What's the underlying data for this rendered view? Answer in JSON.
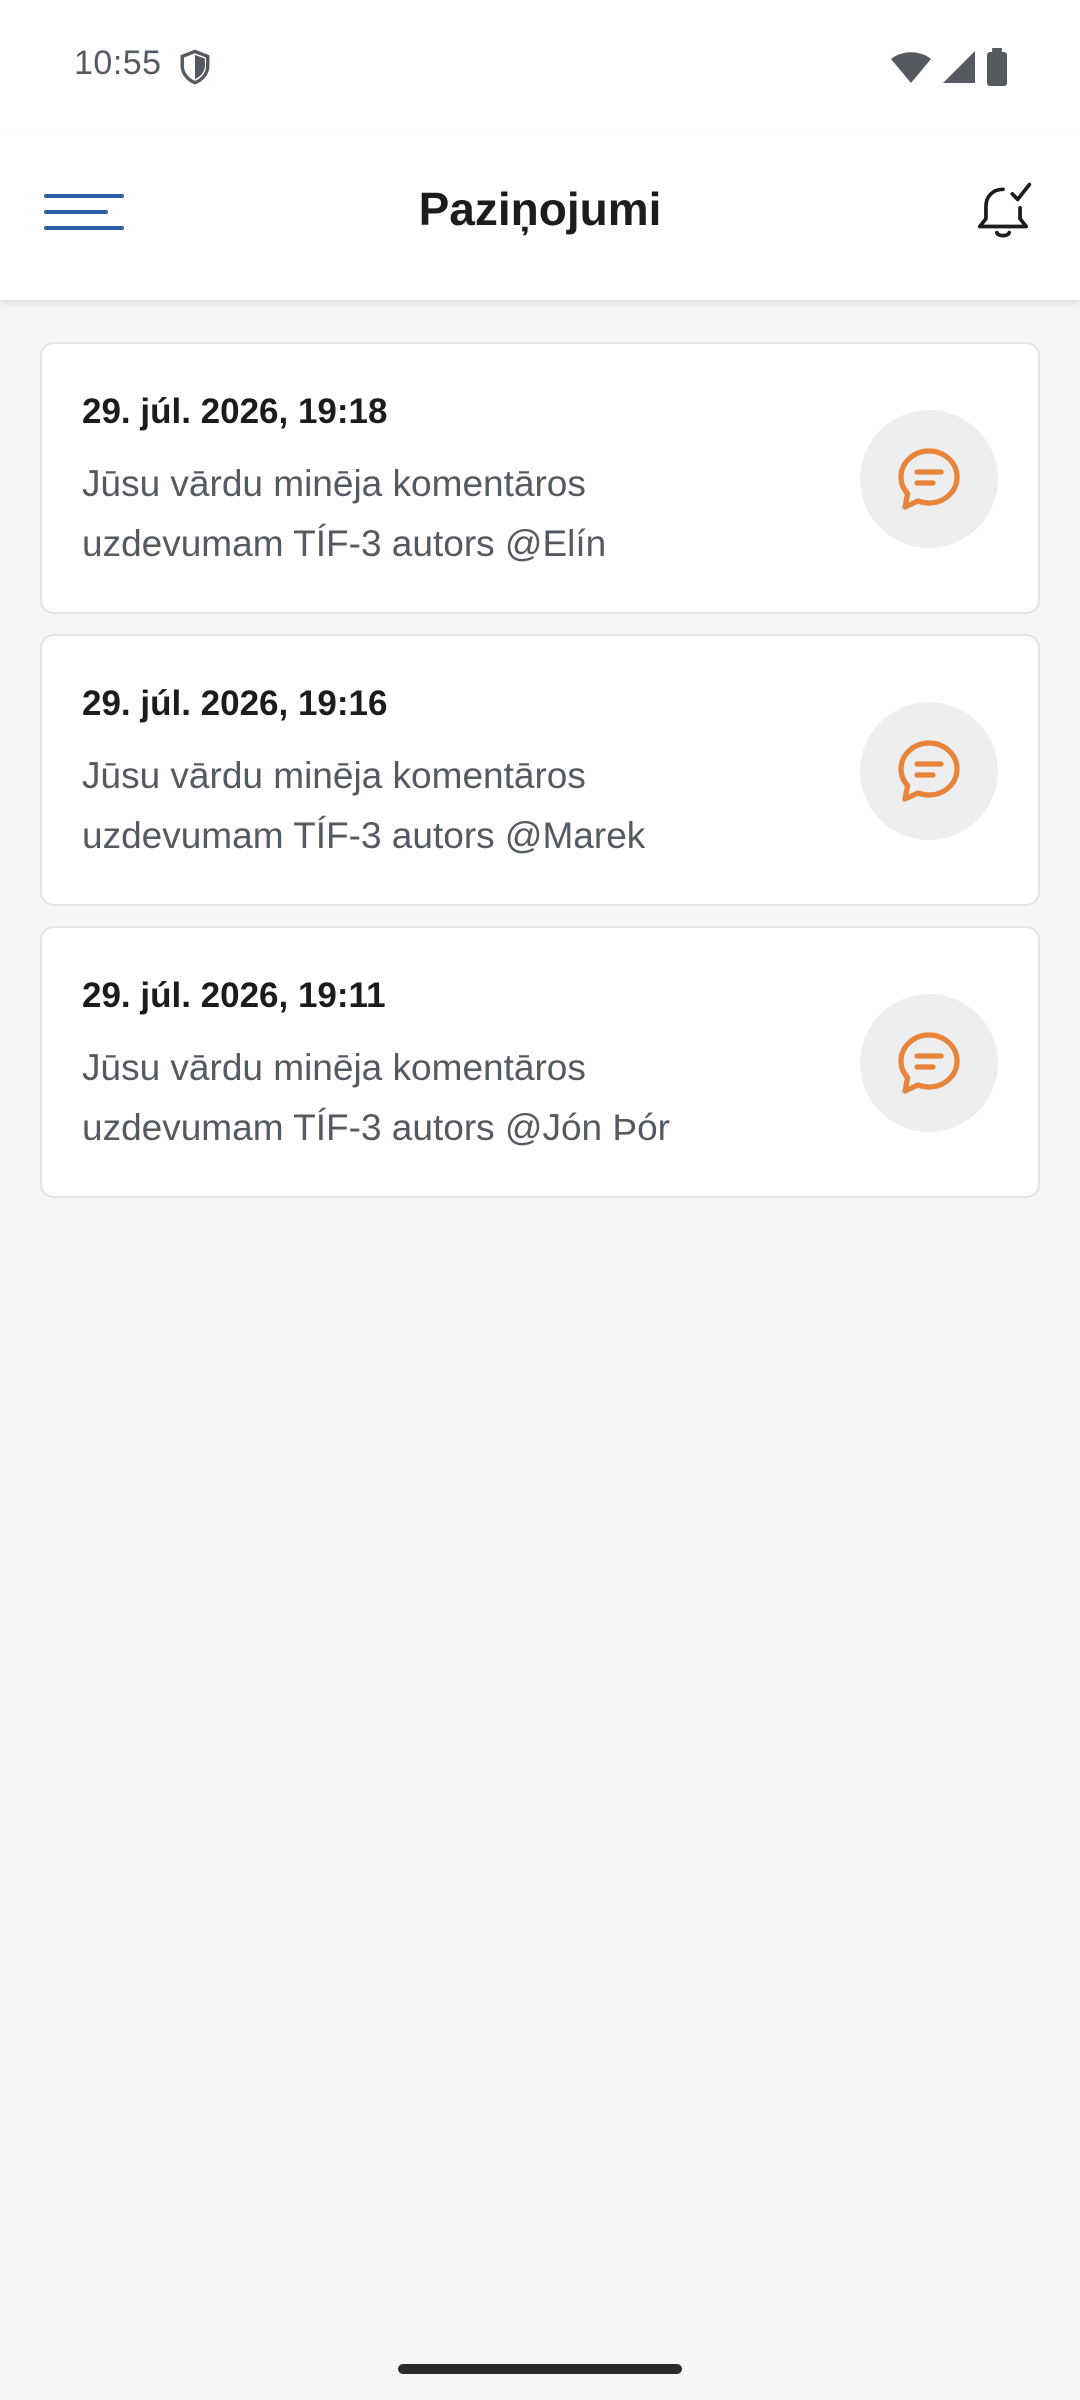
{
  "status_bar": {
    "time": "10:55"
  },
  "app_bar": {
    "title": "Paziņojumi"
  },
  "notifications": [
    {
      "time": "29. júl. 2026, 19:18",
      "line1": "Jūsu vārdu minēja komentāros",
      "line2": "uzdevumam TÍF-3 autors @Elín"
    },
    {
      "time": "29. júl. 2026, 19:16",
      "line1": "Jūsu vārdu minēja komentāros",
      "line2": "uzdevumam TÍF-3 autors @Marek"
    },
    {
      "time": "29. júl. 2026, 19:11",
      "line1": "Jūsu vārdu minēja komentāros",
      "line2": "uzdevumam TÍF-3 autors @Jón Þór"
    }
  ],
  "colors": {
    "accent": "#2f5fa3",
    "comment_icon": "#e8833a",
    "background": "#f6f6f8"
  },
  "icons": {
    "menu": "hamburger-menu-icon",
    "mark_read": "bell-check-icon",
    "notification": "comment-icon"
  }
}
